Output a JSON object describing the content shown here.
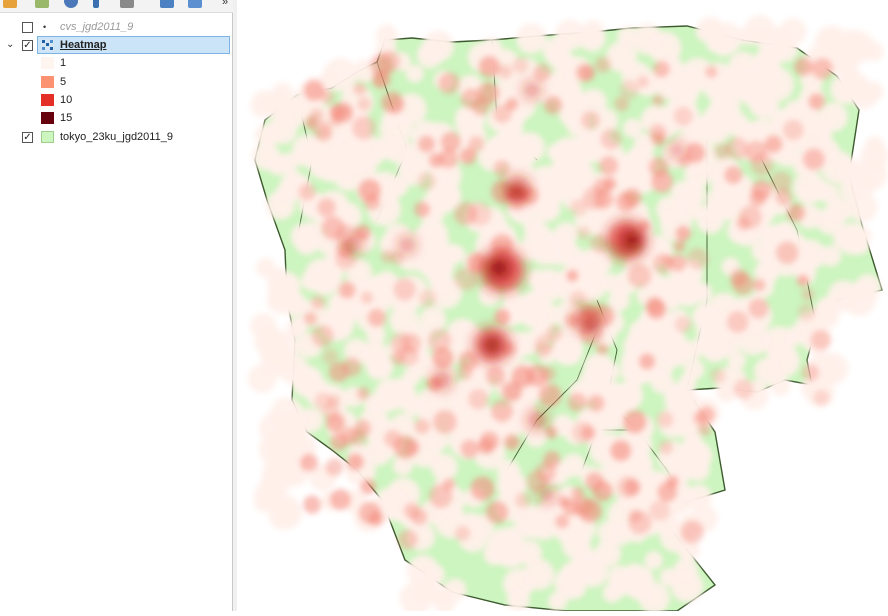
{
  "layers_panel": {
    "toolbar": {
      "more_label": "»",
      "buttons": [
        "open-layer-style-icon",
        "add-group-icon",
        "manage-visibility-icon",
        "filter-legend-icon",
        "filter-by-expression-icon",
        "expand-all-icon",
        "collapse-all-icon"
      ]
    },
    "layers": [
      {
        "name": "cvs_jgd2011_9",
        "checked": false,
        "geometry": "point",
        "style": "italic-gray"
      },
      {
        "name": "Heatmap",
        "checked": true,
        "expanded": true,
        "selected": true,
        "type": "raster",
        "legend": [
          {
            "label": "1",
            "color": "#fff5f0"
          },
          {
            "label": "5",
            "color": "#fc9272"
          },
          {
            "label": "10",
            "color": "#e32f27"
          },
          {
            "label": "15",
            "color": "#67000d"
          }
        ]
      },
      {
        "name": "tokyo_23ku_jgd2011_9",
        "checked": true,
        "geometry": "polygon",
        "color": "#ccf5bf"
      }
    ]
  },
  "map": {
    "colors": {
      "polygon_fill": "#ccf5bf",
      "polygon_stroke": "#3d5a2e",
      "heat_low": "#fff0ea",
      "heat_mid": "#f4887a",
      "heat_high": "#d62418",
      "heat_peak": "#7a0008"
    }
  }
}
